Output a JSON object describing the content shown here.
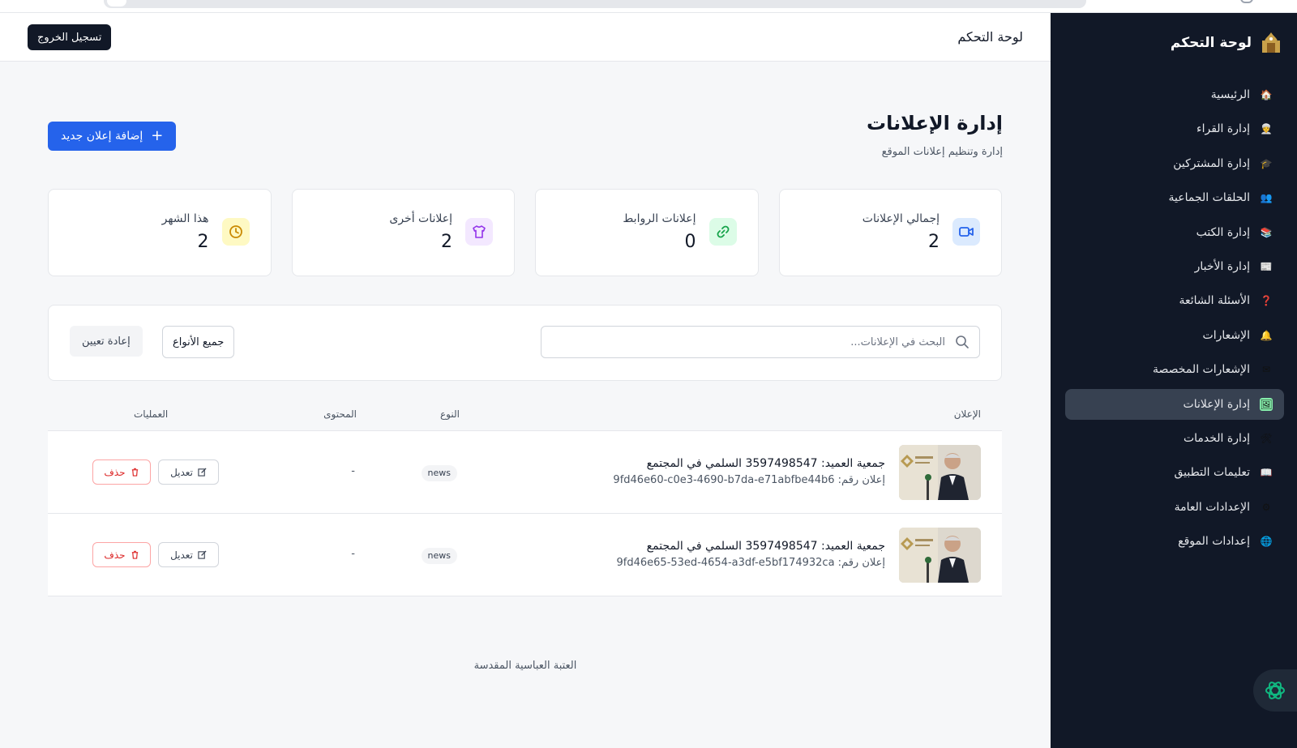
{
  "sidebar": {
    "brand_title": "لوحة التحكم",
    "items": [
      {
        "label": "الرئيسية",
        "icon": "house-icon",
        "glyph": "🏠",
        "active": false
      },
      {
        "label": "إدارة القراء",
        "icon": "reader-icon",
        "glyph": "👳",
        "active": false
      },
      {
        "label": "إدارة المشتركين",
        "icon": "student-icon",
        "glyph": "🎓",
        "active": false
      },
      {
        "label": "الحلقات الجماعية",
        "icon": "group-icon",
        "glyph": "👥",
        "active": false
      },
      {
        "label": "إدارة الكتب",
        "icon": "books-icon",
        "glyph": "📚",
        "active": false
      },
      {
        "label": "إدارة الأخبار",
        "icon": "newspaper-icon",
        "glyph": "📰",
        "active": false
      },
      {
        "label": "الأسئلة الشائعة",
        "icon": "question-icon",
        "glyph": "❓",
        "active": false
      },
      {
        "label": "الإشعارات",
        "icon": "bell-icon",
        "glyph": "🔔",
        "active": false
      },
      {
        "label": "الإشعارات المخصصة",
        "icon": "envelope-icon",
        "glyph": "✉",
        "active": false
      },
      {
        "label": "إدارة الإعلانات",
        "icon": "picture-icon",
        "glyph": "🖼",
        "active": true
      },
      {
        "label": "إدارة الخدمات",
        "icon": "tools-icon",
        "glyph": "🛠",
        "active": false
      },
      {
        "label": "تعليمات التطبيق",
        "icon": "book-icon",
        "glyph": "📖",
        "active": false
      },
      {
        "label": "الإعدادات العامة",
        "icon": "gear-icon",
        "glyph": "⚙",
        "active": false
      },
      {
        "label": "إعدادات الموقع",
        "icon": "globe-icon",
        "glyph": "🌐",
        "active": false
      }
    ]
  },
  "header": {
    "title": "لوحة التحكم",
    "logout_label": "تسجيل الخروج"
  },
  "page": {
    "title": "إدارة الإعلانات",
    "subtitle": "إدارة وتنظيم إعلانات الموقع",
    "add_button": "إضافة إعلان جديد"
  },
  "stats": [
    {
      "label": "إجمالي الإعلانات",
      "value": "2",
      "icon": "video-icon",
      "color": "#2563eb",
      "bg": "#dbeafe"
    },
    {
      "label": "إعلانات الروابط",
      "value": "0",
      "icon": "link-icon",
      "color": "#16a34a",
      "bg": "#dcfce7"
    },
    {
      "label": "إعلانات أخرى",
      "value": "2",
      "icon": "shirt-icon",
      "color": "#9333ea",
      "bg": "#f3e8ff"
    },
    {
      "label": "هذا الشهر",
      "value": "2",
      "icon": "clock-icon",
      "color": "#ca8a04",
      "bg": "#fef9c3"
    }
  ],
  "filters": {
    "search_placeholder": "البحث في الإعلانات...",
    "type_selected": "جميع الأنواع",
    "reset_label": "إعادة تعيين"
  },
  "table": {
    "headers": {
      "ad": "الإعلان",
      "type": "النوع",
      "content": "المحتوى",
      "actions": "العمليات"
    },
    "rows": [
      {
        "title": "جمعية العميد: 3597498547 السلمي في المجتمع",
        "id_line": "إعلان رقم: 9fd46e60-c0e3-4690-b7da-e71abfbe44b6",
        "type": "news",
        "content": "-",
        "edit": "تعديل",
        "delete": "حذف"
      },
      {
        "title": "جمعية العميد: 3597498547 السلمي في المجتمع",
        "id_line": "إعلان رقم: 9fd46e65-53ed-4654-a3df-e5bf174932ca",
        "type": "news",
        "content": "-",
        "edit": "تعديل",
        "delete": "حذف"
      }
    ]
  },
  "footer": {
    "text": "العتبة العباسية المقدسة"
  },
  "colors": {
    "sidebar_bg": "#111827",
    "accent": "#2563eb",
    "danger": "#dc2626"
  }
}
